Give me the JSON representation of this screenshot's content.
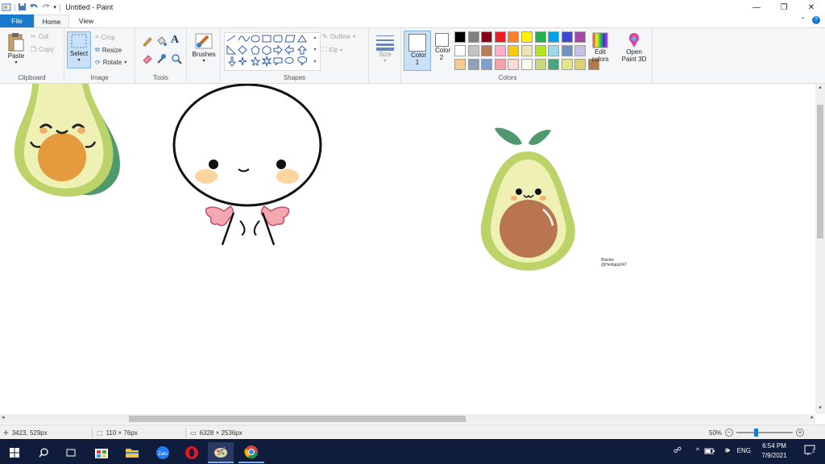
{
  "window": {
    "title": "Untitled - Paint"
  },
  "tabs": {
    "file": "File",
    "home": "Home",
    "view": "View"
  },
  "ribbon": {
    "clipboard": {
      "label": "Clipboard",
      "paste": "Paste",
      "cut": "Cut",
      "copy": "Copy"
    },
    "image": {
      "label": "Image",
      "select": "Select",
      "crop": "Crop",
      "resize": "Resize",
      "rotate": "Rotate"
    },
    "tools": {
      "label": "Tools"
    },
    "brushes": {
      "label": "Brushes"
    },
    "shapes": {
      "label": "Shapes",
      "outline": "Outline",
      "fill": "Fill"
    },
    "size": {
      "label": "Size"
    },
    "colors": {
      "label": "Colors",
      "color1": "Color 1",
      "color2": "Color 2",
      "edit_colors": "Edit colors",
      "open_paint3d": "Open Paint 3D",
      "palette_row1": [
        "#000000",
        "#7f7f7f",
        "#880015",
        "#ed1c24",
        "#ff7f27",
        "#fff200",
        "#22b14c",
        "#00a2e8",
        "#3f48cc",
        "#a349a4"
      ],
      "palette_row2": [
        "#ffffff",
        "#c3c3c3",
        "#b97a57",
        "#ffaec9",
        "#ffc90e",
        "#efe4b0",
        "#b5e61d",
        "#99d9ea",
        "#7092be",
        "#c8bfe7"
      ],
      "palette_row3": [
        "#f7c98a",
        "#8fa0b8",
        "#7f9fd0",
        "#f6a3a7",
        "#f8dcd2",
        "#fcfcf0",
        "#c8d87a",
        "#4aa582",
        "#e8e68a",
        "#dcd27a",
        "#b07a4c"
      ]
    }
  },
  "canvas": {
    "signature_line1": "Blackie",
    "signature_line2": "@Heldapp247"
  },
  "status": {
    "cursor_pos": "3423, 529px",
    "selection_size": "110 × 76px",
    "image_size": "6328 × 2536px",
    "zoom": "50%"
  },
  "taskbar": {
    "time": "6:54 PM",
    "date": "7/9/2021",
    "lang": "ENG",
    "notifications": "2"
  }
}
